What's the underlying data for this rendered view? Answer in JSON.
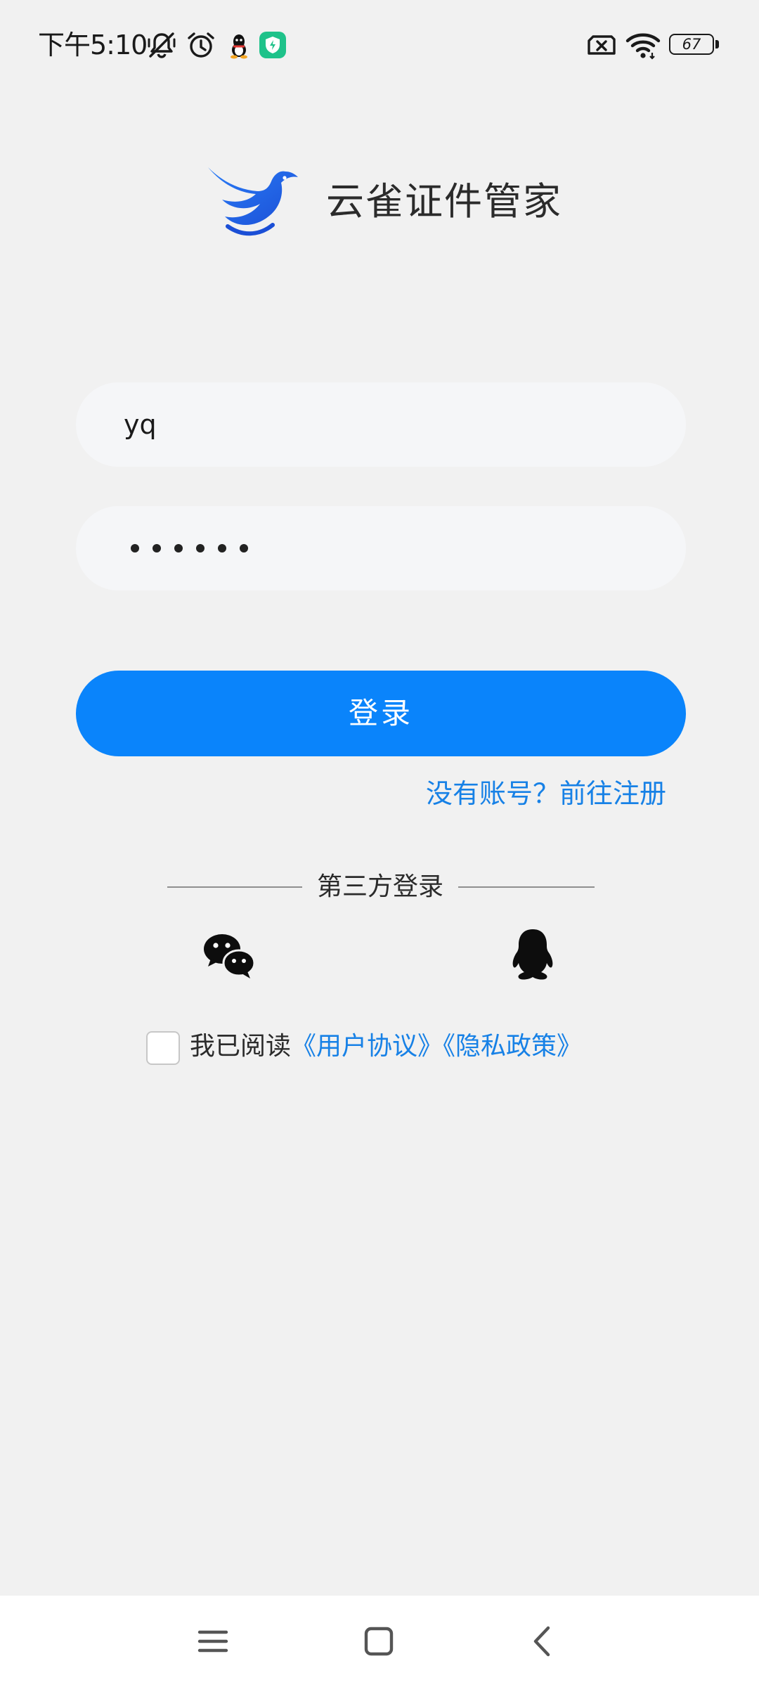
{
  "status_bar": {
    "time": "下午5:10",
    "battery_level": "67",
    "icons": [
      "mute-icon",
      "alarm-icon",
      "qq-notification-icon",
      "shield-app-icon",
      "sim-card-off-icon",
      "wifi-icon",
      "battery-icon"
    ]
  },
  "app": {
    "name": "云雀证件管家",
    "brand_color": "#2d7cf6"
  },
  "login_form": {
    "username_value": "yq",
    "password_masked_length": 6,
    "login_label": "登录",
    "login_color": "#0a84fb",
    "register_link": "没有账号？前往注册"
  },
  "third_party": {
    "label": "第三方登录",
    "options": [
      "wechat-icon",
      "qq-icon"
    ]
  },
  "agreement": {
    "checked": false,
    "prefix": "我已阅读",
    "user_agreement": "《用户协议》",
    "privacy_policy": "《隐私政策》",
    "link_color": "#1781e6"
  },
  "nav_bar": {
    "buttons": [
      "menu-icon",
      "home-icon",
      "back-icon"
    ]
  }
}
